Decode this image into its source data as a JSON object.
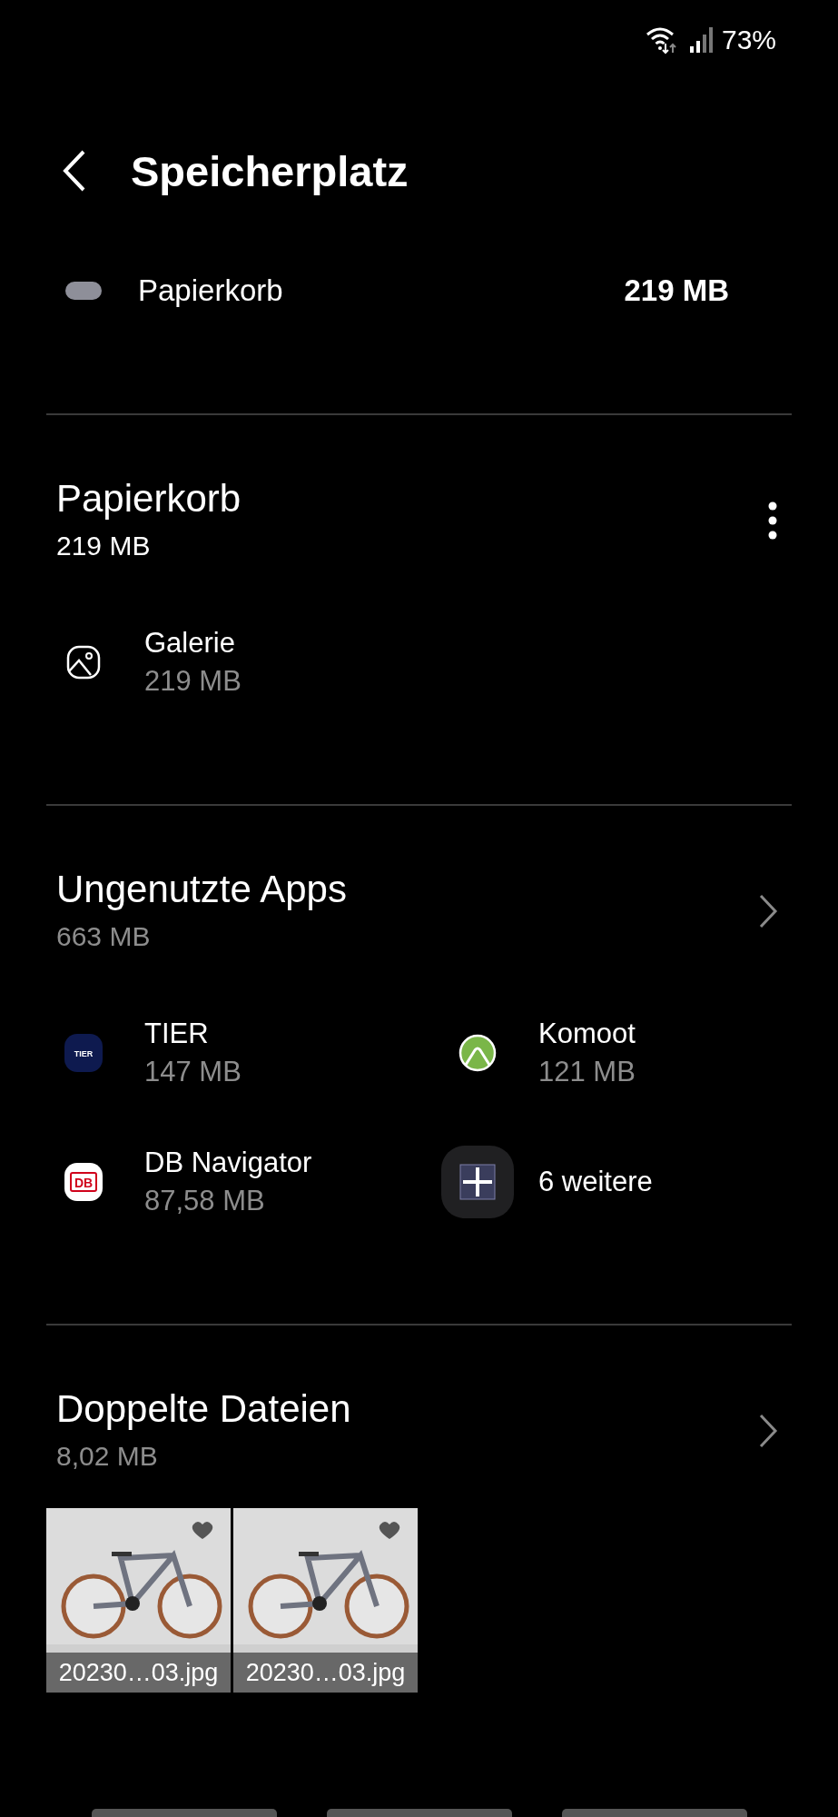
{
  "status_bar": {
    "battery": "73%"
  },
  "header": {
    "title": "Speicherplatz"
  },
  "legend": [
    {
      "label": "Papierkorb",
      "value": "219 MB",
      "color": "#8e8f99"
    }
  ],
  "sections": [
    {
      "kind": "list",
      "menu_button": true,
      "chevron": false,
      "title": "Papierkorb",
      "size": "219 MB",
      "items": [
        {
          "kind": "gallery",
          "name": "Galerie",
          "size": "219 MB"
        }
      ]
    },
    {
      "kind": "grid",
      "menu_button": false,
      "chevron": true,
      "title": "Ungenutzte Apps",
      "size": "663 MB",
      "items": [
        {
          "kind": "tier",
          "icon_text": "TIER",
          "name": "TIER",
          "size": "147 MB"
        },
        {
          "kind": "komoot",
          "name": "Komoot",
          "size": "121 MB"
        },
        {
          "kind": "db",
          "icon_text": "DB",
          "name": "DB Navigator",
          "size": "87,58 MB"
        },
        {
          "kind": "more",
          "name": "6 weitere"
        }
      ]
    },
    {
      "kind": "thumbs",
      "menu_button": false,
      "chevron": true,
      "title": "Doppelte Dateien",
      "size": "8,02 MB",
      "items": [
        {
          "kind": "picture",
          "name": "20230…03.jpg"
        },
        {
          "kind": "picture",
          "name": "20230…03.jpg"
        }
      ]
    }
  ]
}
